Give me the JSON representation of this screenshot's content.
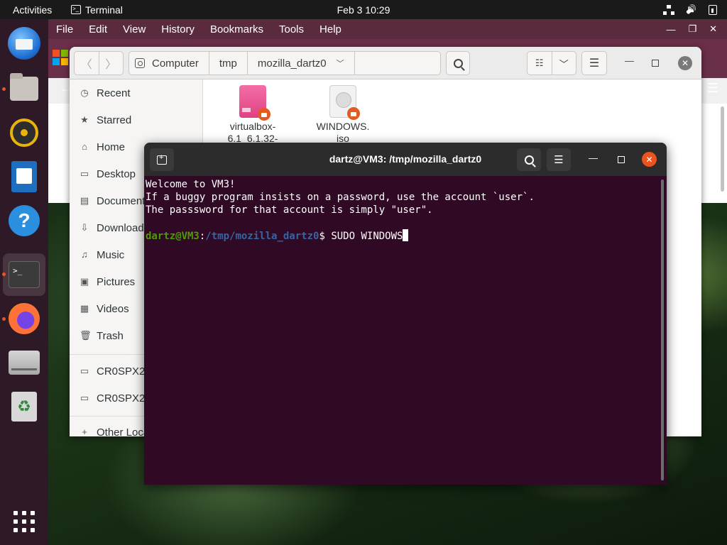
{
  "topbar": {
    "activities": "Activities",
    "app_name": "Terminal",
    "clock": "Feb 3  10:29"
  },
  "dock": {
    "items": [
      {
        "name": "Thunderbird Mail",
        "icon": "thunderbird-icon"
      },
      {
        "name": "Files",
        "icon": "files-icon"
      },
      {
        "name": "Rhythmbox",
        "icon": "rhythmbox-icon"
      },
      {
        "name": "LibreOffice Writer",
        "icon": "writer-icon"
      },
      {
        "name": "Help",
        "icon": "help-icon"
      },
      {
        "name": "Terminal",
        "icon": "terminal-icon"
      },
      {
        "name": "Firefox",
        "icon": "firefox-icon"
      },
      {
        "name": "Drive",
        "icon": "drive-icon"
      },
      {
        "name": "Trash",
        "icon": "trash-icon"
      },
      {
        "name": "Show Applications",
        "icon": "app-grid-icon"
      }
    ]
  },
  "browser": {
    "menu": [
      "File",
      "Edit",
      "View",
      "History",
      "Bookmarks",
      "Tools",
      "Help"
    ]
  },
  "files": {
    "path": [
      "Computer",
      "tmp",
      "mozilla_dartz0"
    ],
    "sidebar": [
      {
        "label": "Recent",
        "icon": "clock-icon"
      },
      {
        "label": "Starred",
        "icon": "star-icon"
      },
      {
        "label": "Home",
        "icon": "home-icon"
      },
      {
        "label": "Desktop",
        "icon": "desktop-icon"
      },
      {
        "label": "Documents",
        "icon": "documents-icon"
      },
      {
        "label": "Downloads",
        "icon": "downloads-icon"
      },
      {
        "label": "Music",
        "icon": "music-icon"
      },
      {
        "label": "Pictures",
        "icon": "pictures-icon"
      },
      {
        "label": "Videos",
        "icon": "videos-icon"
      },
      {
        "label": "Trash",
        "icon": "trash-icon"
      },
      {
        "label": "CR0SPX2_",
        "icon": "drive-icon"
      },
      {
        "label": "CR0SPX2_",
        "icon": "drive-icon"
      },
      {
        "label": "Other Locations",
        "icon": "plus-icon"
      }
    ],
    "items": [
      {
        "line1": "virtualbox-",
        "line2": "6.1_6.1.32-"
      },
      {
        "line1": "WINDOWS.",
        "line2": "iso"
      }
    ]
  },
  "terminal": {
    "title": "dartz@VM3: /tmp/mozilla_dartz0",
    "output": [
      "Welcome to VM3!",
      "If a buggy program insists on a password, use the account `user`.",
      "The passsword for that account is simply \"user\"."
    ],
    "prompt_user": "dartz@VM3",
    "prompt_sep": ":",
    "prompt_path": "/tmp/mozilla_dartz0",
    "prompt_symbol": "$ ",
    "command": "SUDO WINDOWS"
  },
  "colors": {
    "terminal_bg": "#300a24",
    "prompt_user": "#4e9a06",
    "prompt_path": "#3465a4",
    "accent": "#e95420"
  }
}
